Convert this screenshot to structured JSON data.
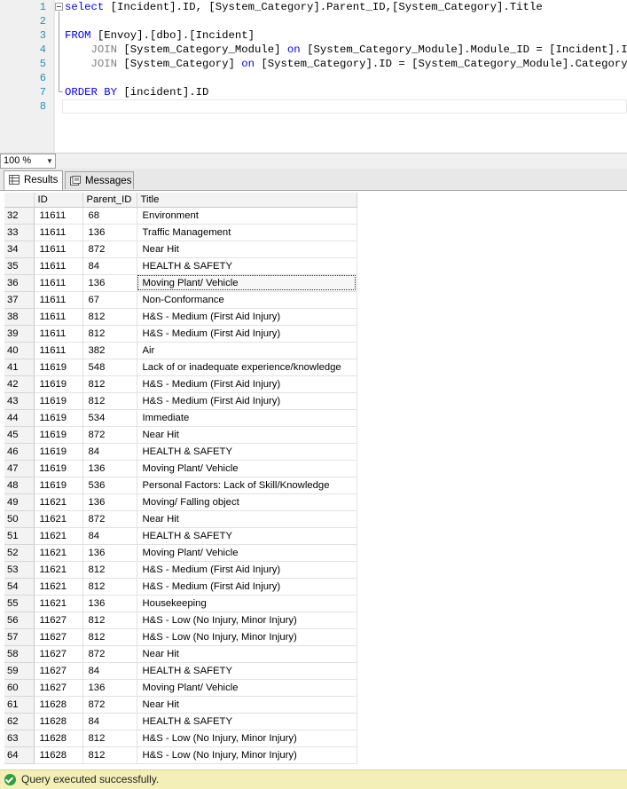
{
  "editor": {
    "lines": [
      {
        "num": "1",
        "parts": [
          {
            "t": "select",
            "c": "kw"
          },
          {
            "t": " [Incident].ID, [System_Category].Parent_ID,[System_Category].Title",
            "c": "pl"
          }
        ]
      },
      {
        "num": "2",
        "parts": []
      },
      {
        "num": "3",
        "parts": [
          {
            "t": "FROM",
            "c": "kw"
          },
          {
            "t": " [Envoy].[dbo].[Incident]",
            "c": "pl"
          }
        ]
      },
      {
        "num": "4",
        "parts": [
          {
            "t": "    JOIN",
            "c": "gr"
          },
          {
            "t": " [System_Category_Module] ",
            "c": "pl"
          },
          {
            "t": "on",
            "c": "kw"
          },
          {
            "t": " [System_Category_Module].Module_ID = [Incident].ID",
            "c": "pl"
          }
        ]
      },
      {
        "num": "5",
        "parts": [
          {
            "t": "    JOIN",
            "c": "gr"
          },
          {
            "t": " [System_Category] ",
            "c": "pl"
          },
          {
            "t": "on",
            "c": "kw"
          },
          {
            "t": " [System_Category].ID = [System_Category_Module].Category_ID",
            "c": "pl"
          }
        ]
      },
      {
        "num": "6",
        "parts": []
      },
      {
        "num": "7",
        "parts": [
          {
            "t": "ORDER BY",
            "c": "kw"
          },
          {
            "t": " [incident].ID",
            "c": "pl"
          }
        ]
      },
      {
        "num": "8",
        "parts": []
      }
    ]
  },
  "zoom": {
    "value": "100 %"
  },
  "tabs": {
    "results": "Results",
    "messages": "Messages"
  },
  "grid": {
    "headers": [
      "",
      "ID",
      "Parent_ID",
      "Title"
    ],
    "rows": [
      [
        "32",
        "11611",
        "68",
        "Environment"
      ],
      [
        "33",
        "11611",
        "136",
        "Traffic Management"
      ],
      [
        "34",
        "11611",
        "872",
        "Near Hit"
      ],
      [
        "35",
        "11611",
        "84",
        "HEALTH & SAFETY"
      ],
      [
        "36",
        "11611",
        "136",
        "Moving Plant/ Vehicle"
      ],
      [
        "37",
        "11611",
        "67",
        "Non-Conformance"
      ],
      [
        "38",
        "11611",
        "812",
        "H&S - Medium (First Aid Injury)"
      ],
      [
        "39",
        "11611",
        "812",
        "H&S - Medium (First Aid Injury)"
      ],
      [
        "40",
        "11611",
        "382",
        "Air"
      ],
      [
        "41",
        "11619",
        "548",
        "Lack of or inadequate experience/knowledge"
      ],
      [
        "42",
        "11619",
        "812",
        "H&S - Medium (First Aid Injury)"
      ],
      [
        "43",
        "11619",
        "812",
        "H&S - Medium (First Aid Injury)"
      ],
      [
        "44",
        "11619",
        "534",
        "Immediate"
      ],
      [
        "45",
        "11619",
        "872",
        "Near Hit"
      ],
      [
        "46",
        "11619",
        "84",
        "HEALTH & SAFETY"
      ],
      [
        "47",
        "11619",
        "136",
        "Moving Plant/ Vehicle"
      ],
      [
        "48",
        "11619",
        "536",
        "Personal Factors: Lack of Skill/Knowledge"
      ],
      [
        "49",
        "11621",
        "136",
        "Moving/ Falling object"
      ],
      [
        "50",
        "11621",
        "872",
        "Near Hit"
      ],
      [
        "51",
        "11621",
        "84",
        "HEALTH & SAFETY"
      ],
      [
        "52",
        "11621",
        "136",
        "Moving Plant/ Vehicle"
      ],
      [
        "53",
        "11621",
        "812",
        "H&S - Medium (First Aid Injury)"
      ],
      [
        "54",
        "11621",
        "812",
        "H&S - Medium (First Aid Injury)"
      ],
      [
        "55",
        "11621",
        "136",
        "Housekeeping"
      ],
      [
        "56",
        "11627",
        "812",
        "H&S - Low (No Injury, Minor Injury)"
      ],
      [
        "57",
        "11627",
        "812",
        "H&S - Low (No Injury, Minor Injury)"
      ],
      [
        "58",
        "11627",
        "872",
        "Near Hit"
      ],
      [
        "59",
        "11627",
        "84",
        "HEALTH & SAFETY"
      ],
      [
        "60",
        "11627",
        "136",
        "Moving Plant/ Vehicle"
      ],
      [
        "61",
        "11628",
        "872",
        "Near Hit"
      ],
      [
        "62",
        "11628",
        "84",
        "HEALTH & SAFETY"
      ],
      [
        "63",
        "11628",
        "812",
        "H&S - Low (No Injury, Minor Injury)"
      ],
      [
        "64",
        "11628",
        "812",
        "H&S - Low (No Injury, Minor Injury)"
      ]
    ],
    "selected_row": "36"
  },
  "status": {
    "message": "Query executed successfully.",
    "color": "#f3efb6"
  }
}
